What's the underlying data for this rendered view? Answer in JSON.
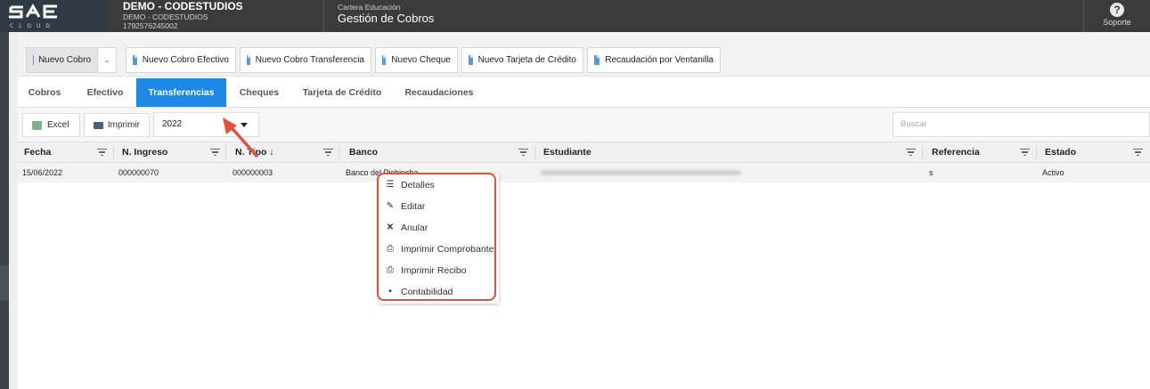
{
  "app": {
    "logo_text": "SAE",
    "logo_sub": "CLOUD",
    "company_name": "DEMO - CODESTUDIOS",
    "company_sub": "DEMO - CODESTUDIOS",
    "company_ruc": "1792576245002",
    "module_section": "Cartera Educación",
    "module_title": "Gestión de Cobros",
    "support_label": "Soporte",
    "support_icon": "question-circle-icon"
  },
  "toolbar": {
    "buttons": [
      {
        "label": "Nuevo Cobro",
        "icon": "document-icon"
      },
      {
        "label": "Nuevo Cobro Efectivo",
        "icon": "document-icon"
      },
      {
        "label": "Nuevo Cobro Transferencia",
        "icon": "document-icon"
      },
      {
        "label": "Nuevo Cheque",
        "icon": "document-icon"
      },
      {
        "label": "Nuevo Tarjeta de Crédito",
        "icon": "document-icon"
      },
      {
        "label": "Recaudación por Ventanilla",
        "icon": "document-icon"
      }
    ]
  },
  "tabs": [
    {
      "label": "Cobros",
      "active": false
    },
    {
      "label": "Efectivo",
      "active": false
    },
    {
      "label": "Transferencias",
      "active": true
    },
    {
      "label": "Cheques",
      "active": false
    },
    {
      "label": "Tarjeta de Crédito",
      "active": false
    },
    {
      "label": "Recaudaciones",
      "active": false
    }
  ],
  "grid_toolbar": {
    "excel_label": "Excel",
    "print_label": "Imprimir",
    "year_value": "2022",
    "search_placeholder": "Buscar"
  },
  "columns": [
    {
      "label": "Fecha"
    },
    {
      "label": "N. Ingreso"
    },
    {
      "label": "N. Tipo ↓"
    },
    {
      "label": "Banco"
    },
    {
      "label": "Estudiante"
    },
    {
      "label": "Referencia"
    },
    {
      "label": "Estado"
    }
  ],
  "rows": [
    {
      "fecha": "15/06/2022",
      "ingreso": "000000070",
      "tipo": "000000003",
      "banco": "Banco del Pichincha",
      "referencia": "s",
      "estado": "Activo"
    }
  ],
  "context_menu": [
    {
      "label": "Detalles",
      "icon": "list-icon"
    },
    {
      "label": "Editar",
      "icon": "pencil-icon"
    },
    {
      "label": "Anular",
      "icon": "close-icon"
    },
    {
      "label": "Imprimir Comprobante",
      "icon": "printer-icon"
    },
    {
      "label": "Imprimir Recibo",
      "icon": "printer-icon"
    },
    {
      "label": "Contabilidad",
      "icon": "book-icon"
    }
  ],
  "colors": {
    "topbar": "#3b3b3b",
    "active_tab": "#1e88e5",
    "highlight": "#e0523e"
  }
}
